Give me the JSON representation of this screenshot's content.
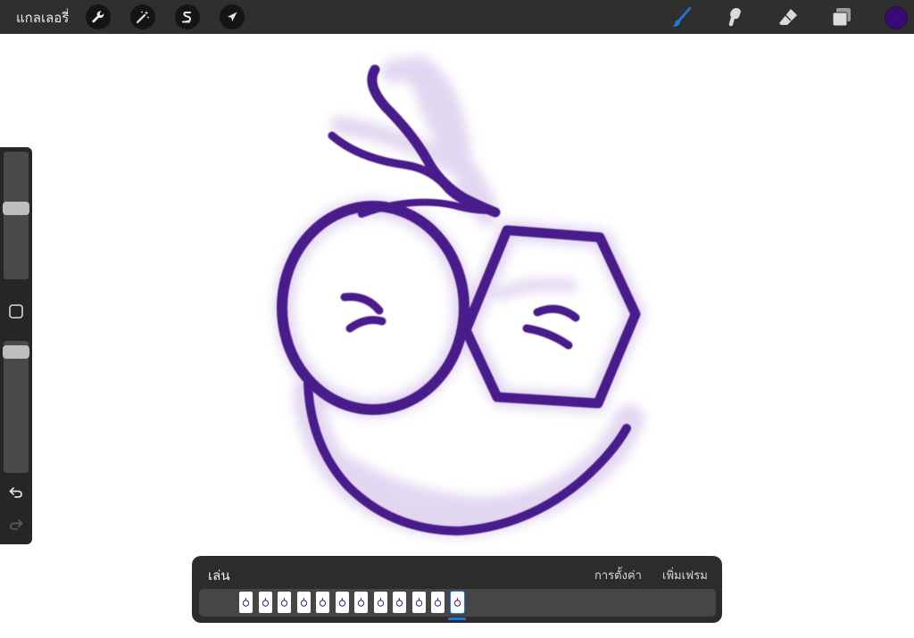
{
  "topbar": {
    "gallery_label": "แกลเลอรี่",
    "left_tools": [
      "wrench-icon",
      "magic-wand-icon",
      "selection-s-icon",
      "transform-arrow-icon"
    ],
    "right_tools": [
      "brush-icon",
      "smudge-icon",
      "eraser-icon",
      "layers-icon"
    ],
    "active_tool": "brush-icon",
    "active_tool_color": "#1f7ae0",
    "current_color": "#3a0a78"
  },
  "sidebar": {
    "brush_size_level": 0.44,
    "opacity_level": 0.04,
    "tools": [
      "modify-square-icon",
      "undo-icon",
      "redo-icon"
    ]
  },
  "canvas": {
    "stroke_color": "#4a1a8c",
    "glow_color": "#cbb6e6"
  },
  "animation": {
    "play_label": "เล่น",
    "settings_label": "การตั้งค่า",
    "add_frame_label": "เพิ่มเฟรม",
    "frame_count": 12,
    "selected_frame": 12
  }
}
